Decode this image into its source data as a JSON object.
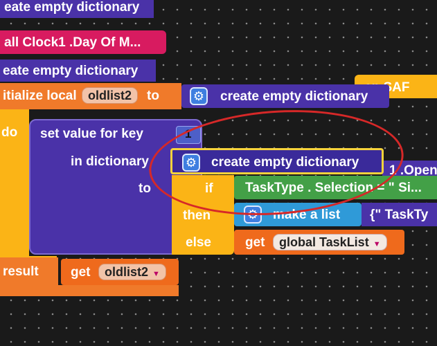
{
  "blocks": {
    "top_dict": "eate empty dictionary",
    "clock_call": "all  Clock1 .Day Of M...",
    "second_dict": "eate empty dictionary",
    "init_local": "itialize local",
    "var_name": "oldlist2",
    "to": "to",
    "create_dict_1": "create empty dictionary",
    "do": "do",
    "set_value": "set value for key",
    "key_num": "1",
    "in_dictionary": "in dictionary",
    "create_dict_2": "create empty dictionary",
    "to2": "to",
    "if": "if",
    "condition": "TaskType . Selection = \" Si...",
    "then": "then",
    "make_list": "make a list",
    "tasktype_frag": "{\" TaskTy",
    "else": "else",
    "get": "get",
    "global_tasklist": "global TaskList",
    "result": "result",
    "get2": "get",
    "oldlist2_ref": "oldlist2",
    "side_then": "en  SAF",
    "side_open": "1 .Open"
  },
  "colors": {
    "procedure_purple": "#4a32a8",
    "variable_orange": "#f07a2a",
    "control_yellow": "#fbb416",
    "logic_green": "#43a047",
    "list_blue": "#2f9ad8",
    "event_pink": "#d81b60",
    "annotation_red": "#d62828"
  }
}
